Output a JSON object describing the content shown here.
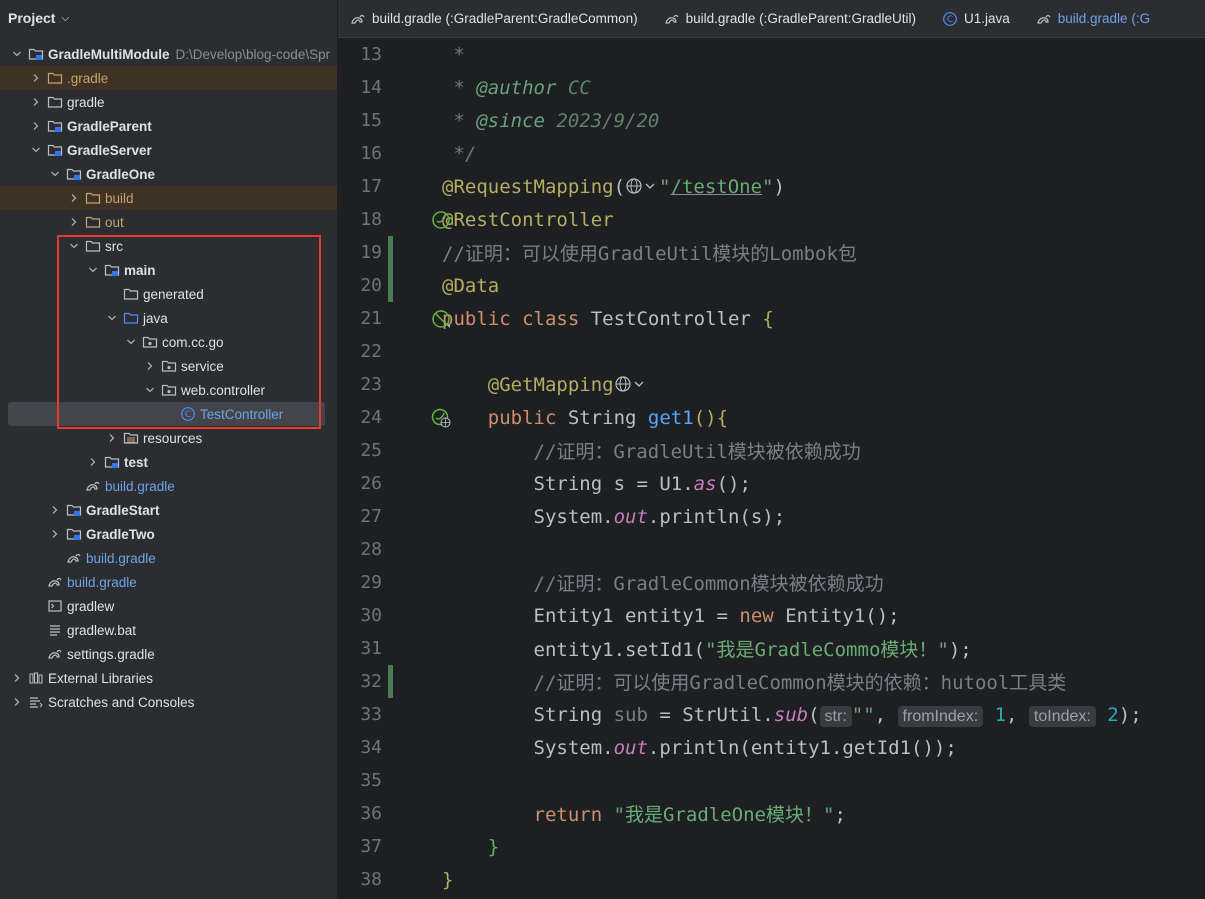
{
  "sidebar": {
    "title": "Project",
    "tree": [
      {
        "label": "GradleMultiModule",
        "path": "D:\\Develop\\blog-code\\Spr",
        "depth": 0,
        "expanded": true,
        "icon": "module-folder-icon",
        "bold": true
      },
      {
        "label": ".gradle",
        "depth": 1,
        "expanded": false,
        "icon": "folder-excluded-icon",
        "style": "excluded"
      },
      {
        "label": "gradle",
        "depth": 1,
        "expanded": false,
        "icon": "folder-icon"
      },
      {
        "label": "GradleParent",
        "depth": 1,
        "expanded": false,
        "icon": "module-folder-icon",
        "bold": true
      },
      {
        "label": "GradleServer",
        "depth": 1,
        "expanded": true,
        "icon": "module-folder-icon",
        "bold": true
      },
      {
        "label": "GradleOne",
        "depth": 2,
        "expanded": true,
        "icon": "module-folder-icon",
        "bold": true
      },
      {
        "label": "build",
        "depth": 3,
        "expanded": false,
        "icon": "folder-excluded-icon",
        "style": "excluded"
      },
      {
        "label": "out",
        "depth": 3,
        "expanded": false,
        "icon": "folder-excluded-icon",
        "style": "excluded-plain"
      },
      {
        "label": "src",
        "depth": 3,
        "expanded": true,
        "icon": "folder-icon"
      },
      {
        "label": "main",
        "depth": 4,
        "expanded": true,
        "icon": "module-folder-icon",
        "bold": true
      },
      {
        "label": "generated",
        "depth": 5,
        "expanded": null,
        "icon": "folder-icon"
      },
      {
        "label": "java",
        "depth": 5,
        "expanded": true,
        "icon": "source-folder-icon"
      },
      {
        "label": "com.cc.go",
        "depth": 6,
        "expanded": true,
        "icon": "package-icon"
      },
      {
        "label": "service",
        "depth": 7,
        "expanded": false,
        "icon": "package-icon"
      },
      {
        "label": "web.controller",
        "depth": 7,
        "expanded": true,
        "icon": "package-icon"
      },
      {
        "label": "TestController",
        "depth": 8,
        "expanded": null,
        "icon": "class-icon",
        "style": "selected"
      },
      {
        "label": "resources",
        "depth": 5,
        "expanded": false,
        "icon": "resources-folder-icon"
      },
      {
        "label": "test",
        "depth": 4,
        "expanded": false,
        "icon": "module-folder-icon",
        "bold": true
      },
      {
        "label": "build.gradle",
        "depth": 3,
        "expanded": null,
        "icon": "gradle-icon",
        "style": "link"
      },
      {
        "label": "GradleStart",
        "depth": 2,
        "expanded": false,
        "icon": "module-folder-icon",
        "bold": true
      },
      {
        "label": "GradleTwo",
        "depth": 2,
        "expanded": false,
        "icon": "module-folder-icon",
        "bold": true
      },
      {
        "label": "build.gradle",
        "depth": 2,
        "expanded": null,
        "icon": "gradle-icon",
        "style": "link"
      },
      {
        "label": "build.gradle",
        "depth": 1,
        "expanded": null,
        "icon": "gradle-icon",
        "style": "link"
      },
      {
        "label": "gradlew",
        "depth": 1,
        "expanded": null,
        "icon": "terminal-file-icon"
      },
      {
        "label": "gradlew.bat",
        "depth": 1,
        "expanded": null,
        "icon": "text-file-icon"
      },
      {
        "label": "settings.gradle",
        "depth": 1,
        "expanded": null,
        "icon": "gradle-icon"
      },
      {
        "label": "External Libraries",
        "depth": 0,
        "expanded": false,
        "icon": "libraries-icon"
      },
      {
        "label": "Scratches and Consoles",
        "depth": 0,
        "expanded": false,
        "icon": "scratches-icon"
      }
    ]
  },
  "tabs": [
    {
      "label": "build.gradle (:GradleParent:GradleCommon)",
      "icon": "gradle-icon"
    },
    {
      "label": "build.gradle (:GradleParent:GradleUtil)",
      "icon": "gradle-icon"
    },
    {
      "label": "U1.java",
      "icon": "class-icon"
    },
    {
      "label": "build.gradle (:G",
      "icon": "gradle-icon",
      "partial": true
    }
  ],
  "editor": {
    "lines": [
      {
        "n": "13",
        "tokens": [
          {
            "t": " *",
            "c": "doc"
          }
        ]
      },
      {
        "n": "14",
        "tokens": [
          {
            "t": " * ",
            "c": "doc"
          },
          {
            "t": "@author",
            "c": "doctag"
          },
          {
            "t": " CC",
            "c": "doc"
          }
        ]
      },
      {
        "n": "15",
        "tokens": [
          {
            "t": " * ",
            "c": "doc"
          },
          {
            "t": "@since",
            "c": "doctag"
          },
          {
            "t": " 2023/9/20",
            "c": "doc"
          }
        ]
      },
      {
        "n": "16",
        "tokens": [
          {
            "t": " */",
            "c": "doc"
          }
        ]
      },
      {
        "n": "17",
        "tokens": [
          {
            "t": "@RequestMapping",
            "c": "ann"
          },
          {
            "t": "(",
            "c": ""
          },
          {
            "t": "@globe",
            "c": "globe"
          },
          {
            "t": "\"",
            "c": "str"
          },
          {
            "t": "/testOne",
            "c": "str under"
          },
          {
            "t": "\"",
            "c": "str"
          },
          {
            "t": ")",
            "c": ""
          }
        ]
      },
      {
        "n": "18",
        "tokens": [
          {
            "t": "@RestController",
            "c": "ann"
          }
        ],
        "gutter": "bean-icon"
      },
      {
        "n": "19",
        "tokens": [
          {
            "t": "//证明：可以使用GradleUtil模块的Lombok包",
            "c": "cm"
          }
        ],
        "bar": true
      },
      {
        "n": "20",
        "tokens": [
          {
            "t": "@Data",
            "c": "ann"
          }
        ],
        "bar": true
      },
      {
        "n": "21",
        "tokens": [
          {
            "t": "public class ",
            "c": "kw"
          },
          {
            "t": "TestController ",
            "c": ""
          },
          {
            "t": "{",
            "c": "ann"
          }
        ],
        "gutter": "bean-off-icon"
      },
      {
        "n": "22",
        "tokens": []
      },
      {
        "n": "23",
        "tokens": [
          {
            "t": "    @GetMapping",
            "c": "ann"
          },
          {
            "t": "@globe",
            "c": "globe"
          }
        ]
      },
      {
        "n": "24",
        "tokens": [
          {
            "t": "    public ",
            "c": "kw"
          },
          {
            "t": "String ",
            "c": ""
          },
          {
            "t": "get1",
            "c": "fn"
          },
          {
            "t": "(){",
            "c": "ann"
          }
        ],
        "gutter": "endpoint-icon"
      },
      {
        "n": "25",
        "tokens": [
          {
            "t": "        //证明：GradleUtil模块被依赖成功",
            "c": "cm"
          }
        ]
      },
      {
        "n": "26",
        "tokens": [
          {
            "t": "        String s = U1.",
            "c": ""
          },
          {
            "t": "as",
            "c": "st"
          },
          {
            "t": "();",
            "c": ""
          }
        ]
      },
      {
        "n": "27",
        "tokens": [
          {
            "t": "        System.",
            "c": ""
          },
          {
            "t": "out",
            "c": "st"
          },
          {
            "t": ".println(s);",
            "c": ""
          }
        ]
      },
      {
        "n": "28",
        "tokens": []
      },
      {
        "n": "29",
        "tokens": [
          {
            "t": "        //证明：GradleCommon模块被依赖成功",
            "c": "cm"
          }
        ]
      },
      {
        "n": "30",
        "tokens": [
          {
            "t": "        Entity1 entity1 = ",
            "c": ""
          },
          {
            "t": "new ",
            "c": "kw"
          },
          {
            "t": "Entity1();",
            "c": ""
          }
        ]
      },
      {
        "n": "31",
        "tokens": [
          {
            "t": "        entity1.setId1(",
            "c": ""
          },
          {
            "t": "\"我是GradleCommo模块！\"",
            "c": "str"
          },
          {
            "t": ");",
            "c": ""
          }
        ]
      },
      {
        "n": "32",
        "tokens": [
          {
            "t": "        //证明：可以使用GradleCommon模块的依赖：hutool工具类",
            "c": "cm"
          }
        ],
        "bar": true
      },
      {
        "n": "33",
        "tokens": [
          {
            "t": "        String ",
            "c": ""
          },
          {
            "t": "sub",
            "c": "cm"
          },
          {
            "t": " = StrUtil.",
            "c": ""
          },
          {
            "t": "sub",
            "c": "st"
          },
          {
            "t": "(",
            "c": ""
          },
          {
            "t": "str:",
            "c": "hint"
          },
          {
            "t": "\"\"",
            "c": "str"
          },
          {
            "t": ", ",
            "c": ""
          },
          {
            "t": "fromIndex:",
            "c": "hint"
          },
          {
            "t": " 1",
            "c": "num"
          },
          {
            "t": ", ",
            "c": ""
          },
          {
            "t": "toIndex:",
            "c": "hint"
          },
          {
            "t": " 2",
            "c": "num"
          },
          {
            "t": ");",
            "c": ""
          }
        ]
      },
      {
        "n": "34",
        "tokens": [
          {
            "t": "        System.",
            "c": ""
          },
          {
            "t": "out",
            "c": "st"
          },
          {
            "t": ".println(entity1.getId1());",
            "c": ""
          }
        ]
      },
      {
        "n": "35",
        "tokens": []
      },
      {
        "n": "36",
        "tokens": [
          {
            "t": "        return ",
            "c": "kw"
          },
          {
            "t": "\"我是GradleOne模块！\"",
            "c": "str"
          },
          {
            "t": ";",
            "c": ""
          }
        ]
      },
      {
        "n": "37",
        "tokens": [
          {
            "t": "    }",
            "c": "str"
          }
        ]
      },
      {
        "n": "38",
        "tokens": [
          {
            "t": "}",
            "c": "ann"
          }
        ]
      }
    ]
  },
  "colors": {
    "accent": "#3574f0",
    "highlight_box": "#e63a2e"
  }
}
